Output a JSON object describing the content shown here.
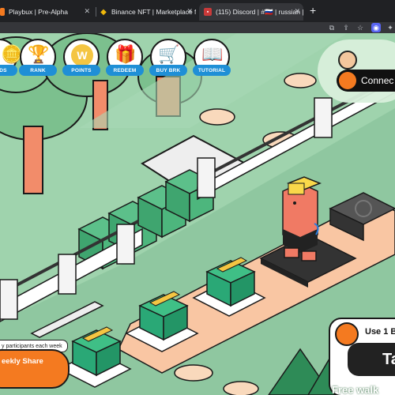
{
  "browser": {
    "tabs": [
      {
        "title": "Playbux | Pre-Alpha",
        "favicon": "playbux-icon",
        "active": false
      },
      {
        "title": "Binance NFT | Marketplace for",
        "favicon": "binance-icon",
        "active": false
      },
      {
        "title": "(115) Discord | #🇷🇺 | russian | ",
        "favicon": "discord-icon",
        "active": true
      }
    ],
    "close_glyph": "✕",
    "new_tab_glyph": "+"
  },
  "nav": {
    "items": [
      {
        "label": "DS",
        "icon": "coins-icon"
      },
      {
        "label": "RANK",
        "icon": "trophy-icon"
      },
      {
        "label": "POINTS",
        "icon": "w-coin-icon"
      },
      {
        "label": "REDEEM",
        "icon": "gift-shop-icon"
      },
      {
        "label": "BUY BRK",
        "icon": "cart-icon"
      },
      {
        "label": "TUTORIAL",
        "icon": "book-icon"
      }
    ]
  },
  "connect": {
    "label": "Connec"
  },
  "weekly": {
    "note": "y participants each week",
    "share_label": "eekly Share"
  },
  "use_panel": {
    "text": "Use 1 B",
    "button_label": "Ta"
  },
  "free_walk": "Free walk",
  "colors": {
    "grass": "#8fc7a0",
    "path": "#f9c6a3",
    "chest": "#2aa876",
    "accent": "#f47a20",
    "label_blue": "#1f8fd6"
  }
}
